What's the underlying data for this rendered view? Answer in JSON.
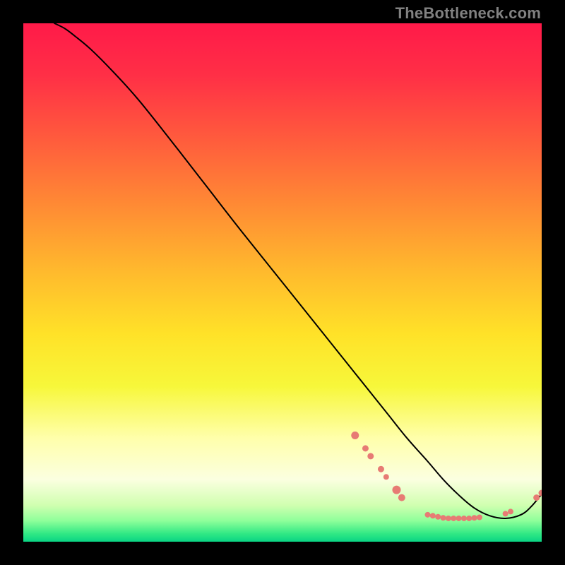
{
  "watermark": "TheBottleneck.com",
  "chart_data": {
    "type": "line",
    "title": "",
    "xlabel": "",
    "ylabel": "",
    "xlim": [
      0,
      100
    ],
    "ylim": [
      0,
      100
    ],
    "grid": false,
    "legend": false,
    "background_gradient": {
      "stops": [
        {
          "pos": 0.0,
          "color": "#ff1a49"
        },
        {
          "pos": 0.1,
          "color": "#ff2f46"
        },
        {
          "pos": 0.22,
          "color": "#ff5a3d"
        },
        {
          "pos": 0.35,
          "color": "#ff8a34"
        },
        {
          "pos": 0.48,
          "color": "#ffba2d"
        },
        {
          "pos": 0.6,
          "color": "#ffe228"
        },
        {
          "pos": 0.7,
          "color": "#f7f73a"
        },
        {
          "pos": 0.8,
          "color": "#ffffab"
        },
        {
          "pos": 0.88,
          "color": "#fbffe0"
        },
        {
          "pos": 0.93,
          "color": "#d0ffb0"
        },
        {
          "pos": 0.96,
          "color": "#8dff9a"
        },
        {
          "pos": 0.985,
          "color": "#2fe884"
        },
        {
          "pos": 1.0,
          "color": "#0ad484"
        }
      ]
    },
    "series": [
      {
        "name": "curve",
        "color": "#000000",
        "x": [
          6,
          8,
          10,
          13,
          17,
          22,
          28,
          35,
          42,
          50,
          58,
          64,
          70,
          74,
          78,
          81,
          84,
          87,
          90,
          93,
          96,
          98,
          100
        ],
        "y": [
          100,
          99,
          97.5,
          95,
          91,
          85.5,
          78,
          69,
          60,
          50,
          40,
          32.5,
          25,
          20,
          15.5,
          12,
          9,
          6.5,
          5,
          4.5,
          5.2,
          6.8,
          9.2
        ]
      }
    ],
    "markers": [
      {
        "x": 64,
        "y": 20.5,
        "r": 5.5,
        "color": "#e77b74"
      },
      {
        "x": 66,
        "y": 18.0,
        "r": 4.5,
        "color": "#e77b74"
      },
      {
        "x": 67,
        "y": 16.5,
        "r": 4.5,
        "color": "#e77b74"
      },
      {
        "x": 69,
        "y": 14.0,
        "r": 4.5,
        "color": "#e77b74"
      },
      {
        "x": 70,
        "y": 12.5,
        "r": 4.0,
        "color": "#e77b74"
      },
      {
        "x": 72,
        "y": 10.0,
        "r": 6.0,
        "color": "#e77b74"
      },
      {
        "x": 73,
        "y": 8.5,
        "r": 5.0,
        "color": "#e77b74"
      },
      {
        "x": 78,
        "y": 5.2,
        "r": 4.0,
        "color": "#e77b74"
      },
      {
        "x": 79,
        "y": 5.0,
        "r": 4.0,
        "color": "#e77b74"
      },
      {
        "x": 80,
        "y": 4.8,
        "r": 4.0,
        "color": "#e77b74"
      },
      {
        "x": 81,
        "y": 4.6,
        "r": 4.0,
        "color": "#e77b74"
      },
      {
        "x": 82,
        "y": 4.5,
        "r": 4.0,
        "color": "#e77b74"
      },
      {
        "x": 83,
        "y": 4.5,
        "r": 4.0,
        "color": "#e77b74"
      },
      {
        "x": 84,
        "y": 4.5,
        "r": 4.0,
        "color": "#e77b74"
      },
      {
        "x": 85,
        "y": 4.5,
        "r": 4.0,
        "color": "#e77b74"
      },
      {
        "x": 86,
        "y": 4.5,
        "r": 4.0,
        "color": "#e77b74"
      },
      {
        "x": 87,
        "y": 4.6,
        "r": 4.0,
        "color": "#e77b74"
      },
      {
        "x": 88,
        "y": 4.7,
        "r": 4.0,
        "color": "#e77b74"
      },
      {
        "x": 93,
        "y": 5.4,
        "r": 4.0,
        "color": "#e77b74"
      },
      {
        "x": 94,
        "y": 5.8,
        "r": 4.0,
        "color": "#e77b74"
      },
      {
        "x": 99,
        "y": 8.5,
        "r": 4.5,
        "color": "#e77b74"
      },
      {
        "x": 100,
        "y": 9.4,
        "r": 4.5,
        "color": "#e77b74"
      }
    ]
  }
}
